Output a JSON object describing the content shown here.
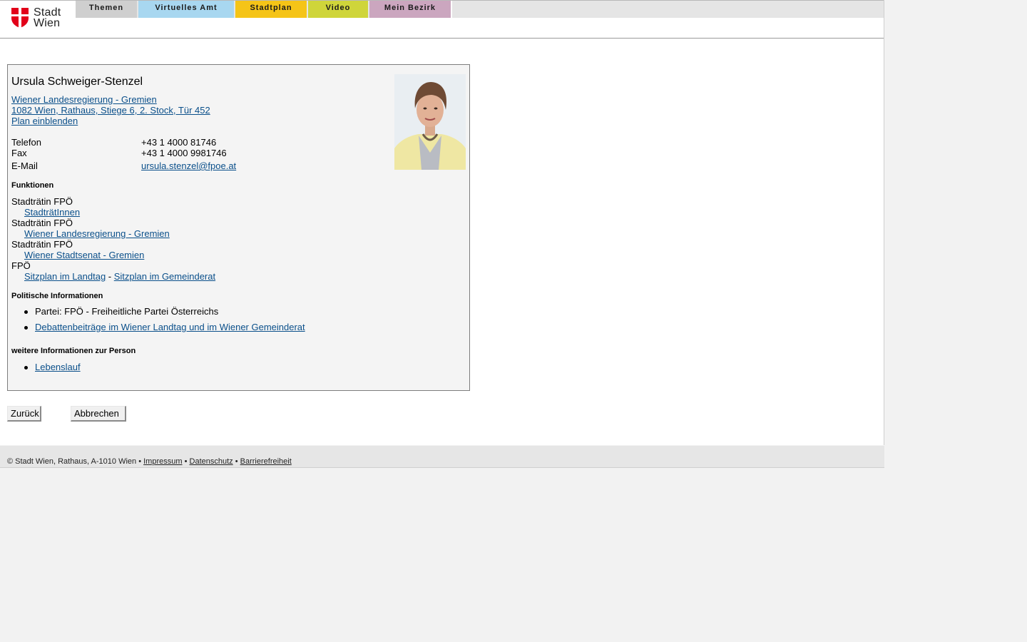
{
  "header": {
    "logo_line1": "Stadt",
    "logo_line2": "Wien",
    "nav": [
      "Themen",
      "Virtuelles Amt",
      "Stadtplan",
      "Video",
      "Mein Bezirk"
    ]
  },
  "person": {
    "name": "Ursula Schweiger-Stenzel",
    "org_link": "Wiener Landesregierung - Gremien",
    "address_link": "1082 Wien, Rathaus, Stiege 6, 2. Stock, Tür 452",
    "plan_link": "Plan einblenden",
    "contact": [
      {
        "label": "Telefon",
        "value": "+43 1 4000 81746"
      },
      {
        "label": "Fax",
        "value": "+43 1 4000 9981746"
      },
      {
        "label": "E-Mail",
        "value": "ursula.stenzel@fpoe.at"
      }
    ]
  },
  "functions": {
    "heading": "Funktionen",
    "items": [
      {
        "title": "Stadträtin FPÖ",
        "link": "StadträtInnen"
      },
      {
        "title": "Stadträtin FPÖ",
        "link": "Wiener Landesregierung - Gremien"
      },
      {
        "title": "Stadträtin FPÖ",
        "link": "Wiener Stadtsenat - Gremien"
      },
      {
        "title": "FPÖ",
        "link": "Sitzplan im Landtag",
        "separator": " - ",
        "link2": "Sitzplan im Gemeinderat"
      }
    ]
  },
  "political": {
    "heading": "Politische Informationen",
    "party": "Partei: FPÖ - Freiheitliche Partei Österreichs",
    "debates_link": "Debattenbeiträge im Wiener Landtag und im Wiener Gemeinderat"
  },
  "further": {
    "heading": "weitere Informationen zur Person",
    "cv_link": "Lebenslauf"
  },
  "buttons": {
    "back": "Zurück",
    "cancel": "Abbrechen"
  },
  "footer": {
    "copyright": "© Stadt Wien, Rathaus, A-1010 Wien",
    "bullet": "•",
    "impressum": "Impressum",
    "datenschutz": "Datenschutz",
    "barrierefreiheit": "Barrierefreiheit"
  },
  "colors": {
    "tab_themen": "#cfcfcf",
    "tab_amt": "#a8d7f0",
    "tab_stadtplan": "#f5c417",
    "tab_video": "#cfd53a",
    "tab_bezirk": "#cba6bf",
    "link": "#0a4f8a",
    "logo_red": "#e2001a"
  }
}
